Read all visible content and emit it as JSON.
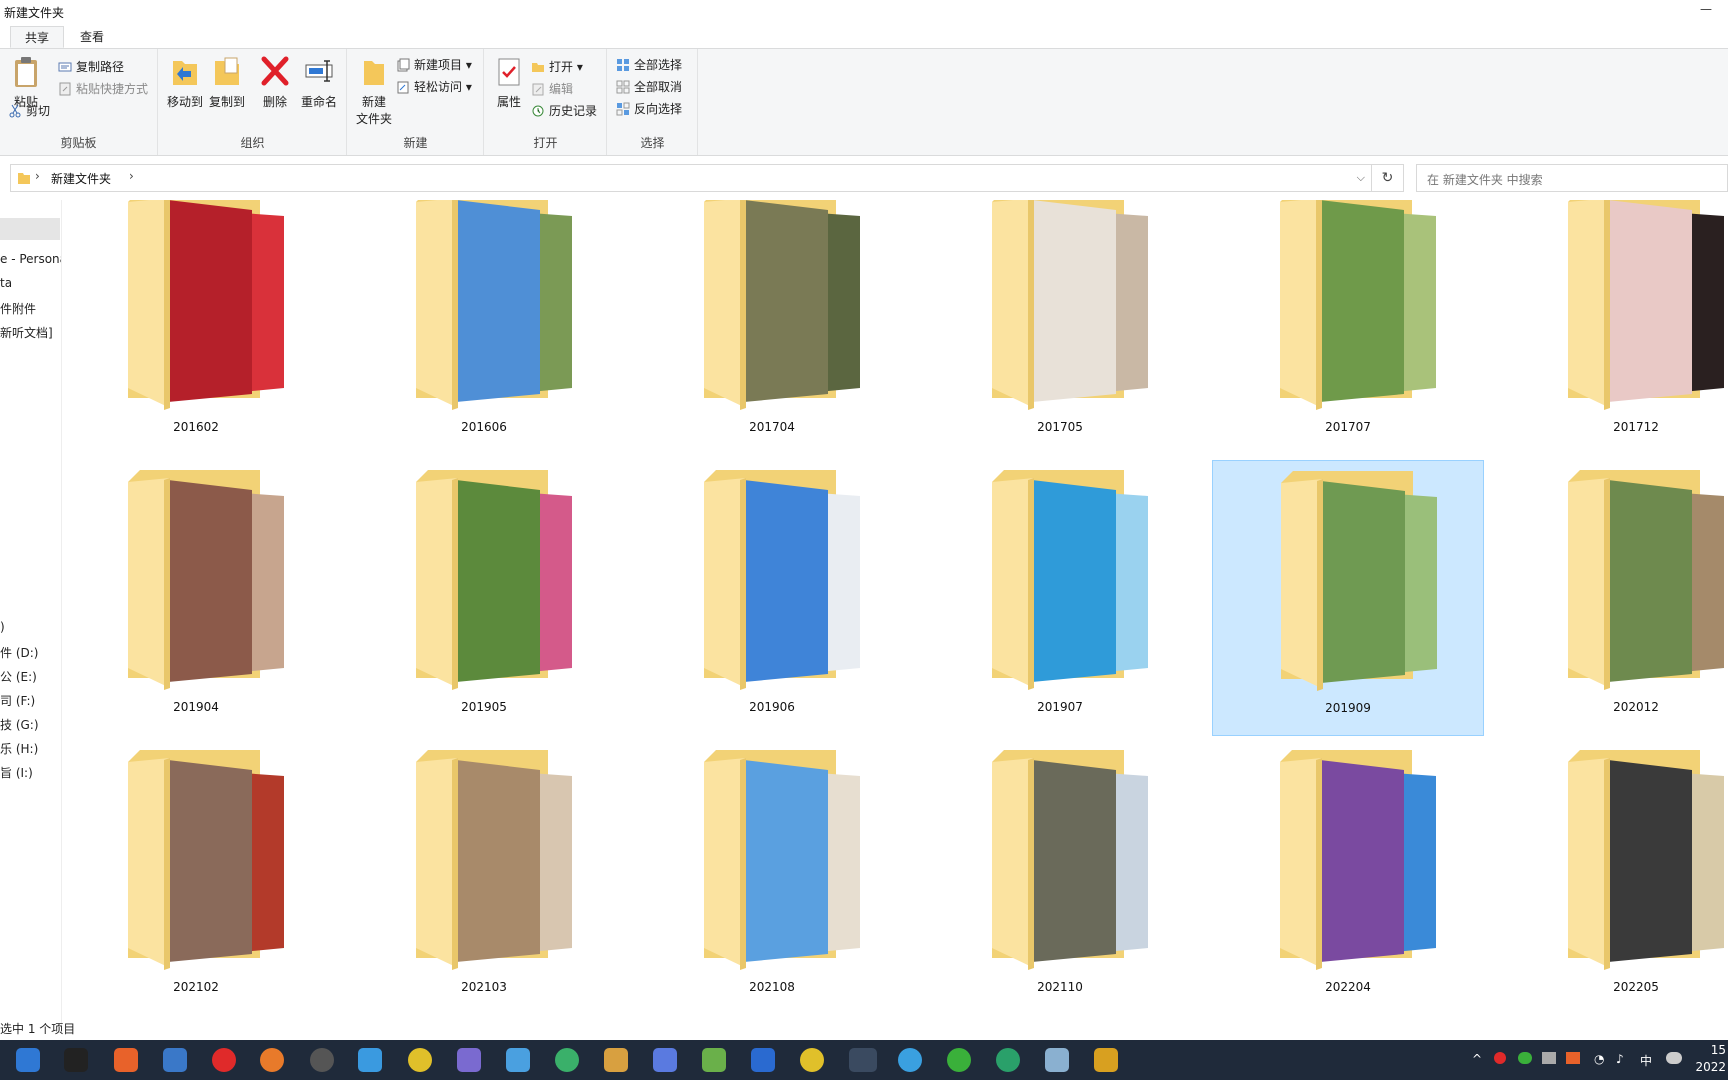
{
  "window": {
    "title": "新建文件夹"
  },
  "tabs": [
    {
      "label": "共享"
    },
    {
      "label": "查看"
    }
  ],
  "ribbon": {
    "clipboard": {
      "paste": "粘贴",
      "copy_path": "复制路径",
      "paste_shortcut": "粘贴快捷方式",
      "cut": "剪切",
      "group": "剪贴板"
    },
    "organize": {
      "move_to": "移动到",
      "copy_to": "复制到",
      "delete": "删除",
      "rename": "重命名",
      "group": "组织"
    },
    "new": {
      "new_folder_line1": "新建",
      "new_folder_line2": "文件夹",
      "new_item": "新建项目",
      "easy_access": "轻松访问",
      "group": "新建"
    },
    "open": {
      "properties": "属性",
      "open": "打开",
      "edit": "编辑",
      "history": "历史记录",
      "group": "打开"
    },
    "select": {
      "select_all": "全部选择",
      "select_none": "全部取消",
      "invert": "反向选择",
      "group": "选择"
    }
  },
  "address": {
    "path": "新建文件夹",
    "search_placeholder": "在 新建文件夹 中搜索"
  },
  "nav": {
    "items": [
      {
        "label": "e - Persona"
      },
      {
        "label": "ta"
      },
      {
        "label": "件附件"
      },
      {
        "label": "新听文档]"
      },
      {
        "label": ")"
      },
      {
        "label": "件 (D:)"
      },
      {
        "label": "公 (E:)"
      },
      {
        "label": "司 (F:)"
      },
      {
        "label": "技 (G:)"
      },
      {
        "label": "乐 (H:)"
      },
      {
        "label": "旨 (I:)"
      }
    ]
  },
  "folders": [
    {
      "name": "201602",
      "colors": [
        "#b5202a",
        "#d9313a"
      ]
    },
    {
      "name": "201606",
      "colors": [
        "#4f8fd6",
        "#7b9a55"
      ]
    },
    {
      "name": "201704",
      "colors": [
        "#7a7a55",
        "#5b6640"
      ]
    },
    {
      "name": "201705",
      "colors": [
        "#e8e1d8",
        "#c9b8a5"
      ]
    },
    {
      "name": "201707",
      "colors": [
        "#6f9a4a",
        "#a9c27a"
      ]
    },
    {
      "name": "201712",
      "colors": [
        "#e9c9c6",
        "#2a2020"
      ]
    },
    {
      "name": "201904",
      "colors": [
        "#8c5a4a",
        "#c7a58e"
      ]
    },
    {
      "name": "201905",
      "colors": [
        "#5c8a3c",
        "#d45a8a"
      ]
    },
    {
      "name": "201906",
      "colors": [
        "#3f84d8",
        "#e9edf2"
      ]
    },
    {
      "name": "201907",
      "colors": [
        "#2f9bd9",
        "#9ad2ef"
      ]
    },
    {
      "name": "201909",
      "colors": [
        "#6f9a52",
        "#9abf7a"
      ]
    },
    {
      "name": "202012",
      "colors": [
        "#6e8a4e",
        "#a58a6a"
      ]
    },
    {
      "name": "202102",
      "colors": [
        "#8a6a5a",
        "#b33a2a"
      ]
    },
    {
      "name": "202103",
      "colors": [
        "#a88a6a",
        "#d8c6b0"
      ]
    },
    {
      "name": "202108",
      "colors": [
        "#5aa0e0",
        "#e7ded0"
      ]
    },
    {
      "name": "202110",
      "colors": [
        "#6a6a5a",
        "#c9d4e0"
      ]
    },
    {
      "name": "202204",
      "colors": [
        "#7a4aa0",
        "#3a8ad8"
      ]
    },
    {
      "name": "202205",
      "colors": [
        "#3a3a3a",
        "#d8caa8"
      ]
    }
  ],
  "status": {
    "text": "选中 1 个项目"
  },
  "taskbar": {
    "ime": "中",
    "clock_line1": "15",
    "clock_line2": "2022"
  }
}
